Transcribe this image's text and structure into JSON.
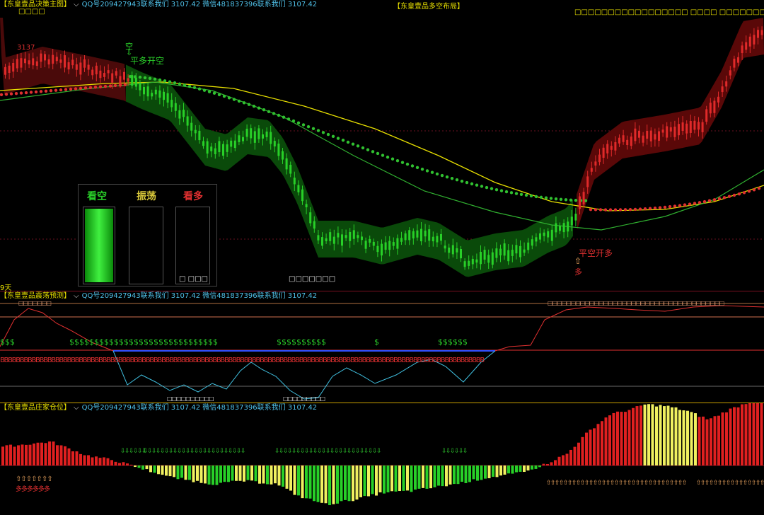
{
  "main_pane": {
    "title": "【东皇壹品决策主图】",
    "info": "QQ号209427943联系我们 3107.42  微信481837396联系我们 3107.42",
    "right_title": "【东皇壹品多空布局】",
    "right_text": "□□□□□□□□□□□□□□□□□  □□□□    □□□□□□□□□□",
    "under_title": "□□□□",
    "price_label": "3137",
    "signal_short_top": "空",
    "signal_short_text": "平多开空",
    "signal_long_text": "平空开多",
    "signal_long_bottom": "多",
    "bottom_text": "□□□□□□□",
    "days_label": "9天",
    "panel": {
      "labels": [
        "看空",
        "振荡",
        "看多"
      ],
      "colors": [
        "#2ad02a",
        "#d9c83a",
        "#e03030"
      ],
      "levels": [
        1.0,
        0.0,
        0.0
      ],
      "footer": "□  □□□"
    }
  },
  "osc_pane": {
    "title": "【东皇壹品震荡预测】",
    "info": "QQ号209427943联系我们 3107.42  微信481837396联系我们 3107.42",
    "top_boxes_left": "□□□□□□□",
    "top_boxes_right": "□□□□□□□□□□□□□□□□□□□□□□□□□□□□□□□□□□□□□□",
    "s_groups": [
      "$$$",
      "$$$$$$$$$$$$$$$$$$$$$$$$$$$$$$",
      "$$$$$$$$$$",
      "$",
      "$$$$$$"
    ],
    "b_row": "BBBBBBBBBBBBBBBBBBBBBBBBBBBBBBBBBBBBBBBBBBBBBBBBBBBBBBBBBBBBBBBBBBBBBBBBBBBBBBBBBBBBBBBBBBBBBBBBBBBBBBBBBBBBBBBBBBBBBBBBBBB",
    "bottom_boxes_1": "□□□□□□□□□□",
    "bottom_boxes_2": "□□□□□□□□□"
  },
  "pos_pane": {
    "title": "【东皇壹品庄家仓位】",
    "info": "QQ号209427943联系我们 3107.42  微信481837396联系我们 3107.42",
    "left_arrows_text": "多多多多多多"
  }
}
